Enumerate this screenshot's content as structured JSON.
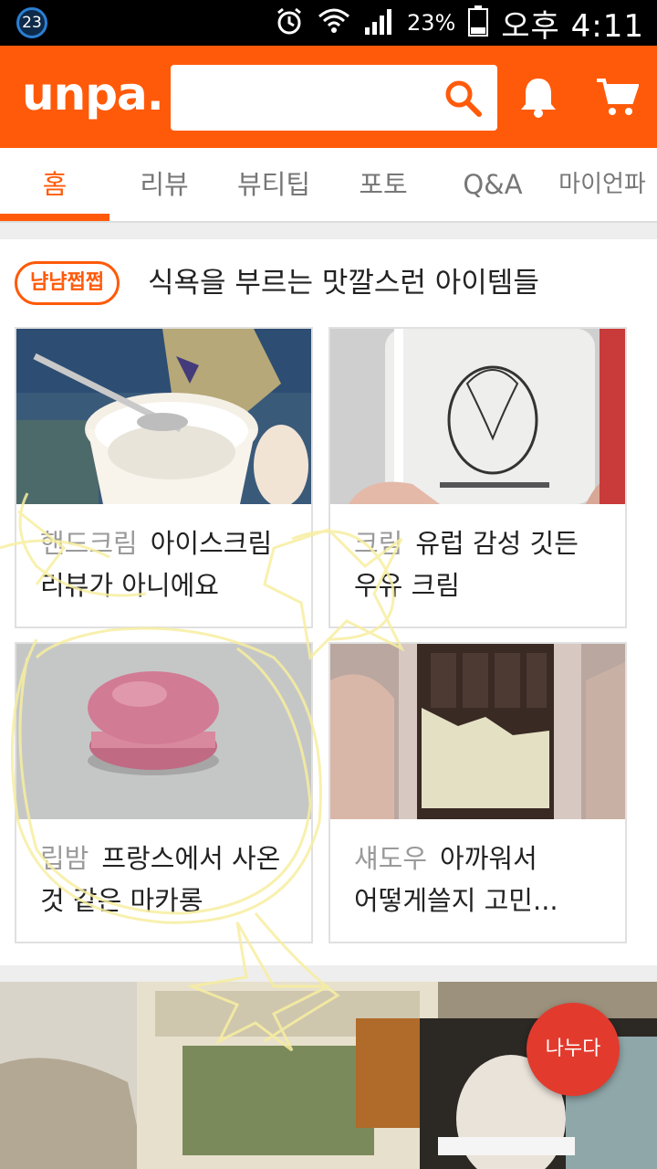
{
  "status_bar": {
    "notification_count": "23",
    "battery": "23%",
    "time": "오후 4:11",
    "icons": [
      "alarm-icon",
      "wifi-icon",
      "signal-icon",
      "battery-icon"
    ]
  },
  "header": {
    "logo": "unpa.",
    "search_placeholder": "",
    "brand_color": "#ff5a0a",
    "icons": [
      "search-icon",
      "bell-icon",
      "cart-icon"
    ]
  },
  "tabs": [
    {
      "label": "홈",
      "active": true
    },
    {
      "label": "리뷰",
      "active": false
    },
    {
      "label": "뷰티팁",
      "active": false
    },
    {
      "label": "포토",
      "active": false
    },
    {
      "label": "Q&A",
      "active": false
    },
    {
      "label": "마이언파",
      "active": false
    }
  ],
  "section": {
    "badge": "냠냠쩝쩝",
    "title": "식욕을 부르는 맛깔스런 아이템들",
    "cards": [
      {
        "category": "핸드크림",
        "title_line1": "아이스크림",
        "title_line2": "리뷰가 아니에요"
      },
      {
        "category": "크림",
        "title_line1": "유럽 감성 깃든",
        "title_line2": "우유 크림"
      },
      {
        "category": "립밤",
        "title_line1": "프랑스에서 사온",
        "title_line2": "것 같은 마카롱"
      },
      {
        "category": "섀도우",
        "title_line1": "아까워서",
        "title_line2": "어떻게쓸지 고민..."
      }
    ]
  },
  "fab": {
    "label": "나누다",
    "color": "#e23b2e"
  }
}
